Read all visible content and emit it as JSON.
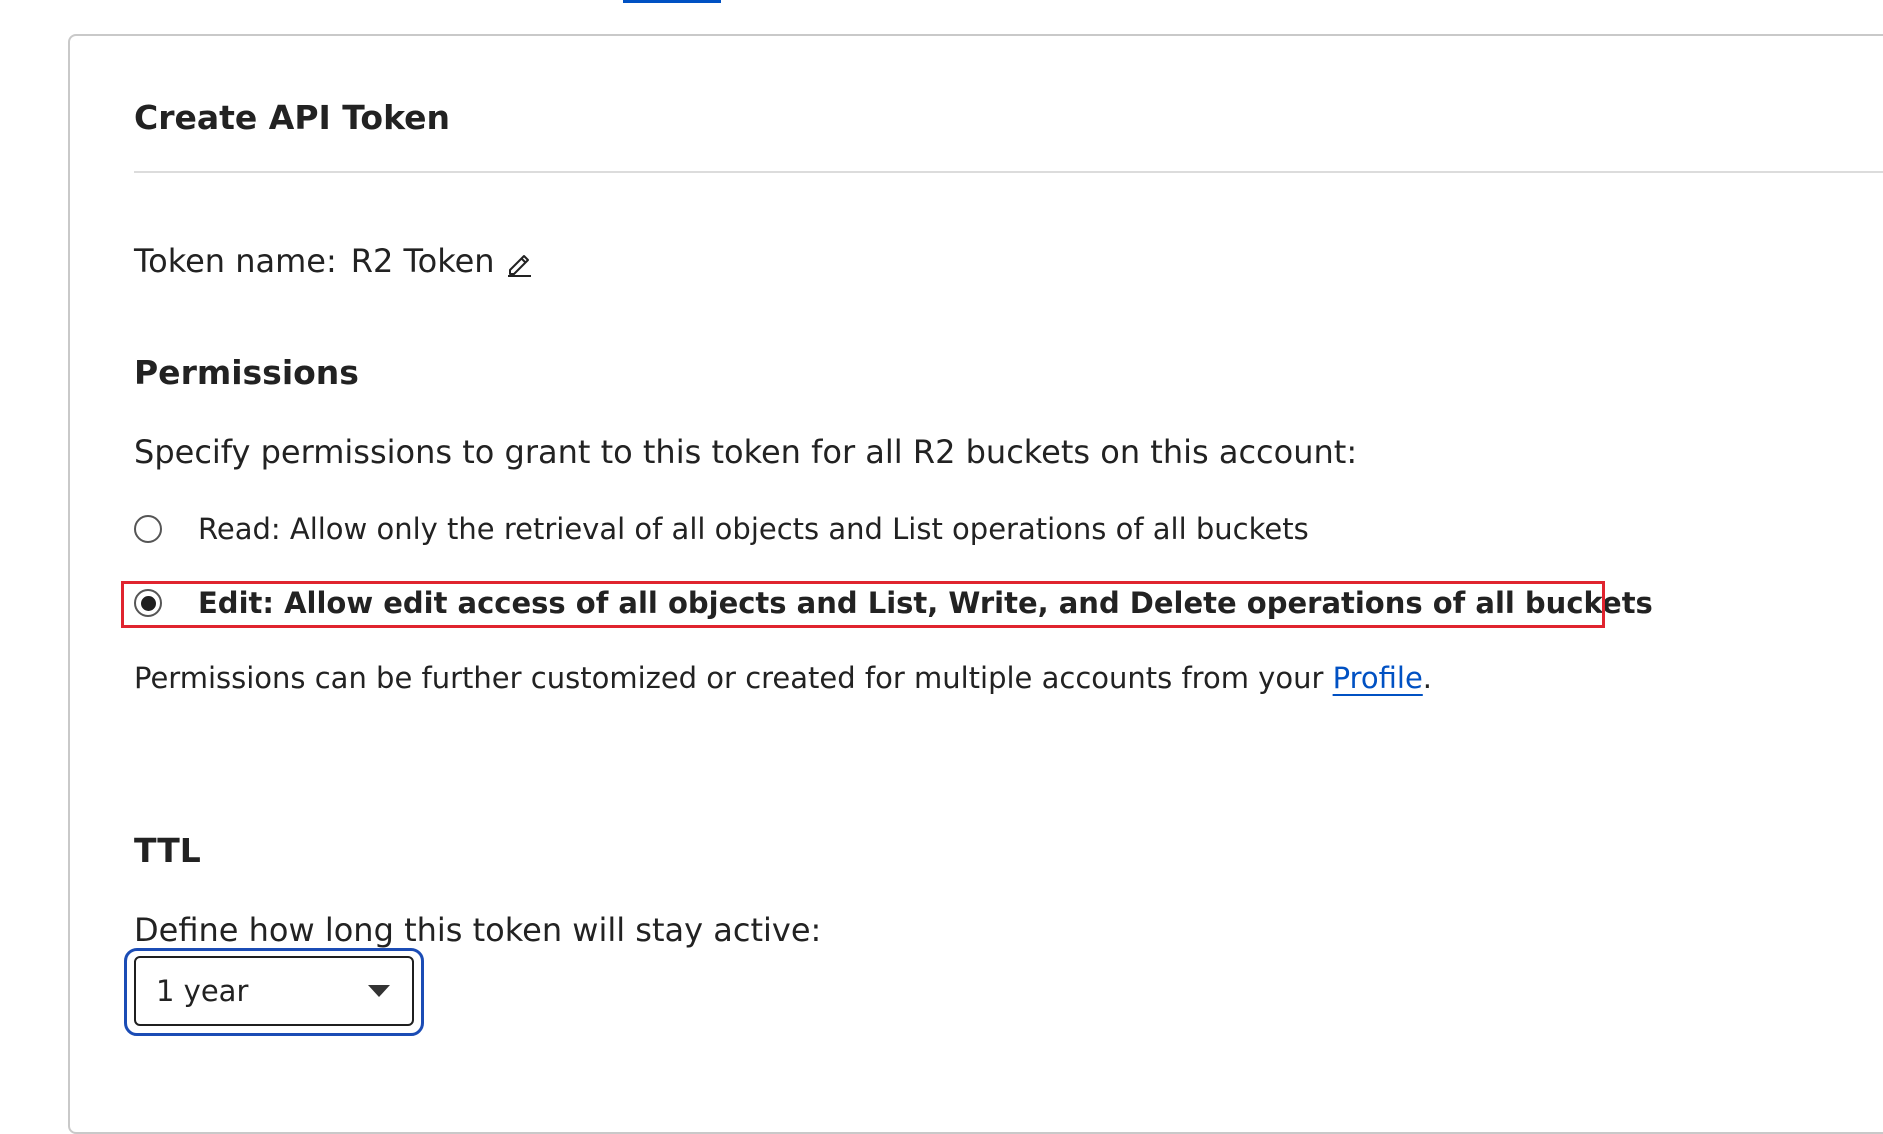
{
  "card": {
    "title": "Create API Token"
  },
  "token": {
    "label": "Token name:",
    "value": "R2 Token",
    "edit_icon": "pencil-icon"
  },
  "permissions": {
    "heading": "Permissions",
    "description": "Specify permissions to grant to this token for all R2 buckets on this account:",
    "options": [
      {
        "label": "Read: Allow only the retrieval of all objects and List operations of all buckets",
        "selected": false
      },
      {
        "label": "Edit: Allow edit access of all objects and List, Write, and Delete operations of all buckets",
        "selected": true
      }
    ],
    "note_prefix": "Permissions can be further customized or created for multiple accounts from your ",
    "note_link": "Profile",
    "note_suffix": "."
  },
  "ttl": {
    "heading": "TTL",
    "description": "Define how long this token will stay active:",
    "selected_value": "1 year",
    "dropdown_icon": "chevron-down-icon"
  },
  "colors": {
    "accent": "#0051c3",
    "highlight_border": "#e0242f",
    "focus_ring": "#1b4cb5"
  }
}
